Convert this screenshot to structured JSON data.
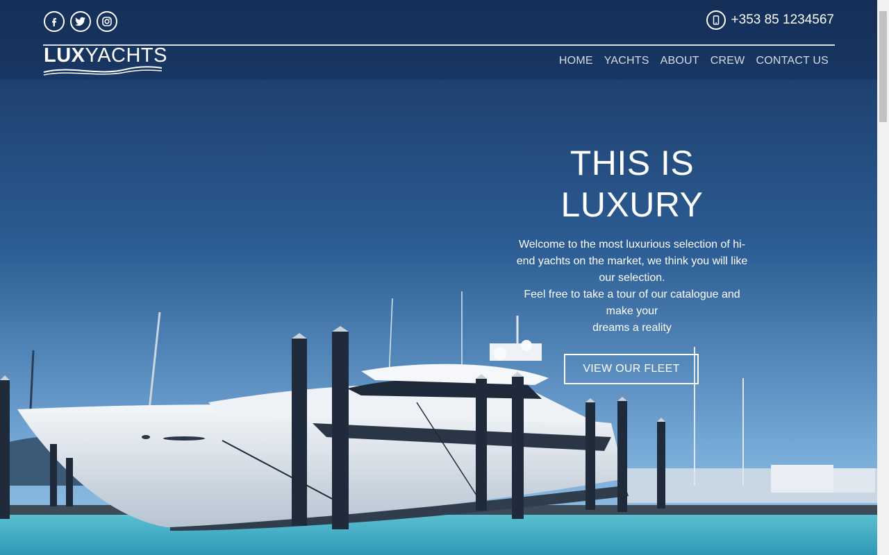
{
  "header": {
    "social": [
      {
        "icon": "facebook-icon",
        "glyph": "f"
      },
      {
        "icon": "twitter-icon",
        "glyph": ""
      },
      {
        "icon": "instagram-icon",
        "glyph": ""
      }
    ],
    "phone": {
      "icon": "mobile-phone-icon",
      "number": "+353 85 1234567"
    },
    "logo": {
      "lux": "LUX",
      "yachts": "YACHTS"
    },
    "nav": [
      "HOME",
      "YACHTS",
      "ABOUT",
      "CREW",
      "CONTACT US"
    ]
  },
  "hero": {
    "title_line1": "THIS IS",
    "title_line2": "LUXURY",
    "text_line1": "Welcome to the most luxurious selection of hi-end yachts on the market, we think you will like our selection.",
    "text_line2": "Feel free to take a tour of our catalogue and make your",
    "text_line3": "dreams a reality",
    "cta_label": "VIEW OUR FLEET"
  },
  "colors": {
    "sky_top": "#17335e",
    "sky_bottom": "#7fb3dd",
    "water": "#3fa9c2",
    "text": "#ffffff"
  }
}
